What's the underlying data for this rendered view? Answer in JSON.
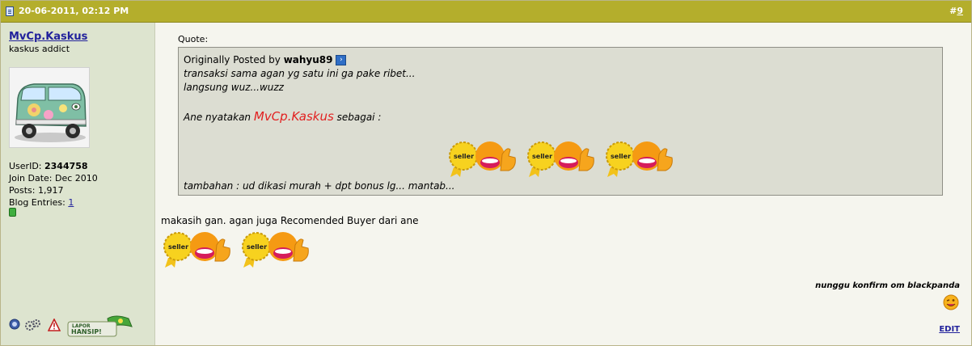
{
  "post": {
    "date": "20-06-2011, 02:12 PM",
    "number_prefix": "#",
    "number": "9"
  },
  "user": {
    "name": "MvCp.Kaskus",
    "title": "kaskus addict",
    "userid_label": "UserID:",
    "userid": "2344758",
    "join_label": "Join Date:",
    "join_date": "Dec 2010",
    "posts_label": "Posts:",
    "posts": "1,917",
    "blog_label": "Blog Entries:",
    "blog_entries": "1",
    "status_color": "#3fae3f",
    "report_badge_line1": "LAPOR",
    "report_badge_line2": "HANSIP!"
  },
  "quote": {
    "label": "Quote:",
    "origin_prefix": "Originally Posted by",
    "origin_user": "wahyu89",
    "line1": "transaksi sama agan yg satu ini ga pake ribet...",
    "line2": "langsung wuz...wuzz",
    "line3_prefix": "Ane nyatakan",
    "line3_highlight": "MvCp.Kaskus",
    "line3_suffix": "sebagai :",
    "line4": "tambahan : ud dikasi murah + dpt bonus lg... mantab...",
    "badge_text": "seller"
  },
  "message": {
    "text": "makasih gan. agan juga Recomended Buyer dari ane",
    "badge_text": "seller"
  },
  "signature": "nunggu konfirm om blackpanda",
  "edit_label": "EDIT",
  "colors": {
    "header_bg": "#b4ae2c",
    "sidebar_bg": "#dde4cf",
    "quote_bg": "#dcddd2",
    "link": "#22229c",
    "highlight_red": "#e22020"
  }
}
